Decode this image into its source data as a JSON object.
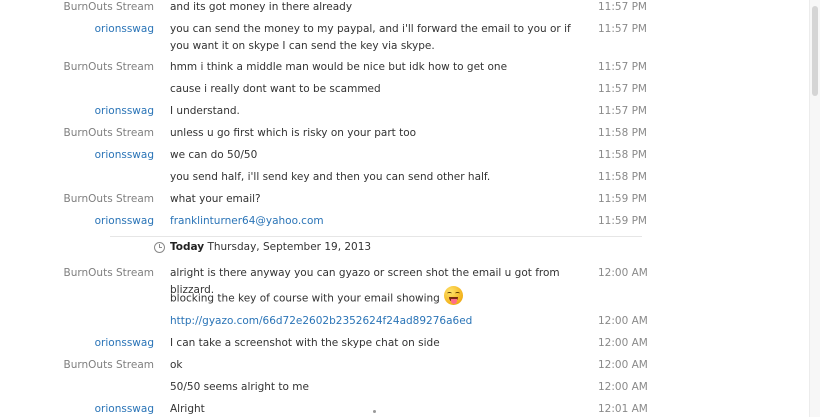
{
  "chat": {
    "messages": [
      {
        "sender": "BurnOuts Stream",
        "text": "and its got money in there already",
        "time": "11:57 PM"
      },
      {
        "sender": "orionsswag",
        "text": "you can send the money to my paypal, and i'll forward the email to you or if you want it on skype I can send the key via skype.",
        "time": "11:57 PM"
      },
      {
        "sender": "BurnOuts Stream",
        "text": "hmm i think a middle man would be nice but idk how to get one",
        "time": "11:57 PM"
      },
      {
        "sender": "",
        "text": "cause i really dont want to be scammed",
        "time": "11:57 PM"
      },
      {
        "sender": "orionsswag",
        "text": "I understand.",
        "time": "11:57 PM"
      },
      {
        "sender": "BurnOuts Stream",
        "text": "unless u go first which is risky on your part too",
        "time": "11:58 PM"
      },
      {
        "sender": "orionsswag",
        "text": "we can do 50/50",
        "time": "11:58 PM"
      },
      {
        "sender": "",
        "text": "you send half, i'll send key and then you can send other half.",
        "time": "11:58 PM"
      },
      {
        "sender": "BurnOuts Stream",
        "text": "what your email?",
        "time": "11:59 PM"
      },
      {
        "sender": "orionsswag",
        "text": "franklinturner64@yahoo.com",
        "time": "11:59 PM"
      },
      {
        "sender": "BurnOuts Stream",
        "text": "alright is there anyway you can gyazo or screen shot the email u got from blizzard.",
        "time": "12:00 AM"
      },
      {
        "sender": "",
        "text": "blocking the key of course with your email showing",
        "time": ""
      },
      {
        "sender": "",
        "text": "http://gyazo.com/66d72e2602b2352624f24ad89276a6ed",
        "time": "12:00 AM"
      },
      {
        "sender": "orionsswag",
        "text": "I can take a screenshot with the skype chat on side",
        "time": "12:00 AM"
      },
      {
        "sender": "BurnOuts Stream",
        "text": "ok",
        "time": "12:00 AM"
      },
      {
        "sender": "",
        "text": "50/50 seems alright to me",
        "time": "12:00 AM"
      },
      {
        "sender": "orionsswag",
        "text": "Alright",
        "time": "12:01 AM"
      }
    ],
    "day_divider": {
      "label": "Today",
      "date": "Thursday, September 19, 2013",
      "icon": "clock-icon"
    },
    "emoji": {
      "icon": "tongue-out-emoji-icon",
      "color": "#f2b11a"
    }
  }
}
